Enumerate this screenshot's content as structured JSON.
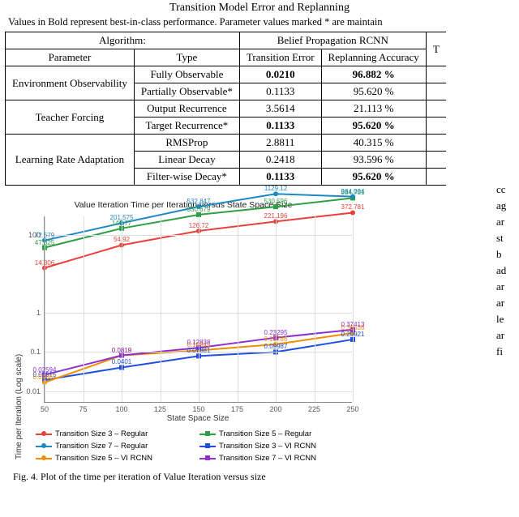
{
  "table": {
    "title": "Transition Model Error and Replanning",
    "subtitle": "Values in Bold represent best-in-class performance. Parameter values marked * are maintain",
    "header_row": {
      "algorithm_label": "Algorithm:",
      "algorithm_name": "Belief Propagation RCNN",
      "param_col": "Parameter",
      "type_col": "Type",
      "te_col": "Transition Error",
      "ra_col": "Replanning Accuracy",
      "t_stub": "T"
    },
    "groups": [
      {
        "param": "Environment Observability",
        "rows": [
          {
            "type": "Fully Observable",
            "te": "0.0210",
            "ra": "96.882 %",
            "bold": true
          },
          {
            "type": "Partially Observable*",
            "te": "0.1133",
            "ra": "95.620 %",
            "bold": false
          }
        ]
      },
      {
        "param": "Teacher Forcing",
        "rows": [
          {
            "type": "Output Recurrence",
            "te": "3.5614",
            "ra": "21.113 %",
            "bold": false
          },
          {
            "type": "Target Recurrence*",
            "te": "0.1133",
            "ra": "95.620 %",
            "bold": true
          }
        ]
      },
      {
        "param": "Learning Rate Adaptation",
        "rows": [
          {
            "type": "RMSProp",
            "te": "2.8811",
            "ra": "40.315 %",
            "bold": false
          },
          {
            "type": "Linear Decay",
            "te": "0.2418",
            "ra": "93.596 %",
            "bold": false
          },
          {
            "type": "Filter-wise Decay*",
            "te": "0.1133",
            "ra": "95.620 %",
            "bold": true
          }
        ]
      }
    ]
  },
  "chart_data": {
    "type": "line",
    "title": "Value Iteration Time per Iteration versus State Space Size",
    "xlabel": "State Space Size",
    "ylabel": "Time per Iteration (Log scale)",
    "x": [
      50,
      100,
      150,
      200,
      250
    ],
    "xticks": [
      50,
      75,
      100,
      125,
      150,
      175,
      200,
      225,
      250
    ],
    "yscale": "log",
    "yticks": [
      0.01,
      0.1,
      1,
      100
    ],
    "ylim": [
      0.005,
      300
    ],
    "series": [
      {
        "name": "Transition Size 3 – Regular",
        "color": "#E8403A",
        "marker": "circle",
        "values": [
          14.306,
          54.92,
          126.72,
          221.196,
          372.781
        ]
      },
      {
        "name": "Transition Size 5 – Regular",
        "color": "#2F9E44",
        "marker": "square",
        "values": [
          47.325,
          147.77,
          330.679,
          530.596,
          884.731
        ]
      },
      {
        "name": "Transition Size 7 – Regular",
        "color": "#1E88C4",
        "marker": "circle",
        "values": [
          72.579,
          201.575,
          532.847,
          1129.12,
          964.004
        ]
      },
      {
        "name": "Transition Size 3 – VI RCNN",
        "color": "#1F4FE0",
        "marker": "square",
        "values": [
          0.01915,
          0.0401,
          0.07881,
          0.09987,
          0.20921
        ]
      },
      {
        "name": "Transition Size 5 – VI RCNN",
        "color": "#F08C00",
        "marker": "circle",
        "values": [
          0.01662,
          0.0818,
          0.10945,
          0.15786,
          0.30536
        ]
      },
      {
        "name": "Transition Size 7 – VI RCNN",
        "color": "#8B2FD1",
        "marker": "square",
        "values": [
          0.02594,
          0.0819,
          0.12838,
          0.23295,
          0.37413
        ]
      }
    ],
    "data_labels": [
      {
        "series": 0,
        "points": [
          [
            50,
            14.306
          ],
          [
            100,
            54.92
          ],
          [
            150,
            126.72
          ],
          [
            200,
            221.196
          ],
          [
            250,
            372.781
          ]
        ]
      },
      {
        "series": 1,
        "points": [
          [
            50,
            47.325
          ],
          [
            100,
            147.77
          ],
          [
            150,
            330.679
          ],
          [
            200,
            530.596
          ],
          [
            250,
            884.731
          ]
        ]
      },
      {
        "series": 2,
        "points": [
          [
            50,
            72.579
          ],
          [
            100,
            201.575
          ],
          [
            150,
            532.847
          ],
          [
            200,
            1129.12
          ],
          [
            250,
            964.004
          ]
        ]
      },
      {
        "series": 3,
        "points": [
          [
            50,
            0.01915
          ],
          [
            100,
            0.0401
          ],
          [
            150,
            0.07881
          ],
          [
            200,
            0.09987
          ],
          [
            250,
            0.20921
          ]
        ]
      },
      {
        "series": 4,
        "points": [
          [
            50,
            0.01662
          ],
          [
            100,
            0.0818
          ],
          [
            150,
            0.10945
          ],
          [
            200,
            0.15786
          ],
          [
            250,
            0.30536
          ]
        ]
      },
      {
        "series": 5,
        "points": [
          [
            50,
            0.02594
          ],
          [
            100,
            0.0819
          ],
          [
            150,
            0.12838
          ],
          [
            200,
            0.23295
          ],
          [
            250,
            0.37413
          ]
        ]
      }
    ]
  },
  "legend": [
    {
      "label": "Transition Size 3 – Regular",
      "color_class": "c-red",
      "marker": "circle"
    },
    {
      "label": "Transition Size 5 – Regular",
      "color_class": "c-green",
      "marker": "square"
    },
    {
      "label": "Transition Size 7 – Regular",
      "color_class": "c-cyan",
      "marker": "circle"
    },
    {
      "label": "Transition Size 3 – VI RCNN",
      "color_class": "c-blue",
      "marker": "square"
    },
    {
      "label": "Transition Size 5 – VI RCNN",
      "color_class": "c-orange",
      "marker": "circle"
    },
    {
      "label": "Transition Size 7 – VI RCNN",
      "color_class": "c-purple",
      "marker": "square"
    }
  ],
  "caption": "Fig. 4.   Plot of the time per iteration of Value Iteration versus size",
  "right_fragments": [
    "cc",
    "ag",
    "ar",
    "st",
    "b",
    "ad",
    "ar",
    "ar",
    "le",
    "ar",
    "fi"
  ]
}
